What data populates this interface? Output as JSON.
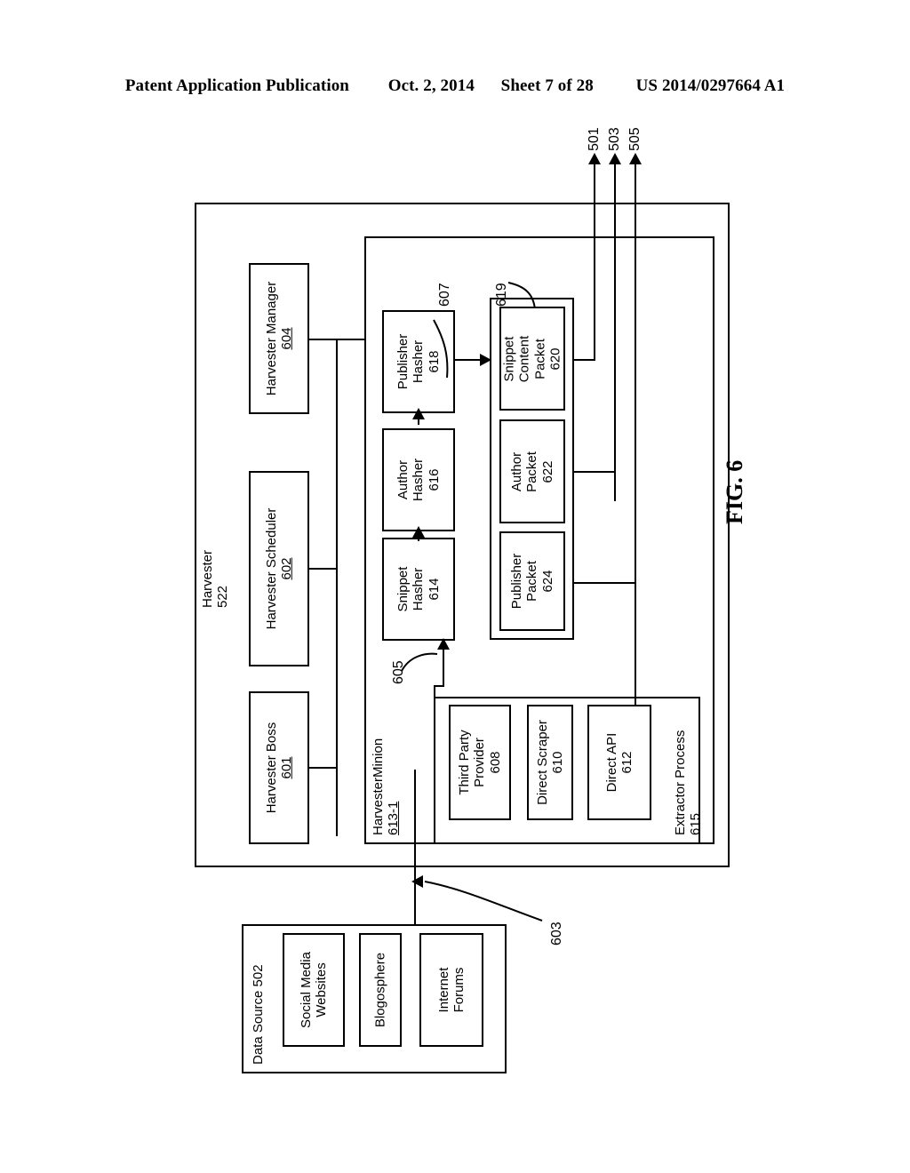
{
  "page_header": {
    "publication": "Patent Application Publication",
    "date": "Oct. 2, 2014",
    "sheet": "Sheet 7 of 28",
    "pub_number": "US 2014/0297664 A1"
  },
  "figure": {
    "label": "FIG. 6"
  },
  "outputs": [
    {
      "id": "501",
      "label": "501"
    },
    {
      "id": "503",
      "label": "503"
    },
    {
      "id": "505",
      "label": "505"
    }
  ],
  "harvester": {
    "title": "Harvester",
    "number": "522",
    "control_blocks": [
      {
        "title": "Harvester Manager",
        "number": "604"
      },
      {
        "title": "Harvester Scheduler",
        "number": "602"
      },
      {
        "title": "Harvester Boss",
        "number": "601"
      }
    ],
    "minion": {
      "title": "HarvesterMinion",
      "number": "613-1",
      "hashers": [
        {
          "title_line1": "Publisher",
          "title_line2": "Hasher",
          "number": "618"
        },
        {
          "title_line1": "Author",
          "title_line2": "Hasher",
          "number": "616"
        },
        {
          "title_line1": "Snippet",
          "title_line2": "Hasher",
          "number": "614"
        }
      ],
      "packet_group_number": "619",
      "packets": [
        {
          "title_line1": "Snippet",
          "title_line2": "Content",
          "title_line3": "Packet",
          "number": "620"
        },
        {
          "title_line1": "Author",
          "title_line2": "Packet",
          "number": "622"
        },
        {
          "title_line1": "Publisher",
          "title_line2": "Packet",
          "number": "624"
        }
      ],
      "extractor": {
        "title": "Extractor Process",
        "number": "615",
        "items": [
          {
            "title_line1": "Third Party",
            "title_line2": "Provider",
            "number": "608"
          },
          {
            "title_line1": "Direct Scraper",
            "number": "610"
          },
          {
            "title_line1": "Direct API",
            "number": "612"
          }
        ]
      }
    }
  },
  "data_source": {
    "title": "Data Source 502",
    "items": [
      {
        "line1": "Social Media",
        "line2": "Websites"
      },
      {
        "line1": "Blogosphere"
      },
      {
        "line1": "Internet",
        "line2": "Forums"
      }
    ]
  },
  "callouts": {
    "hasher_flow": "607",
    "packet_group": "619",
    "extract_arrow": "605",
    "source_arrow": "603"
  }
}
